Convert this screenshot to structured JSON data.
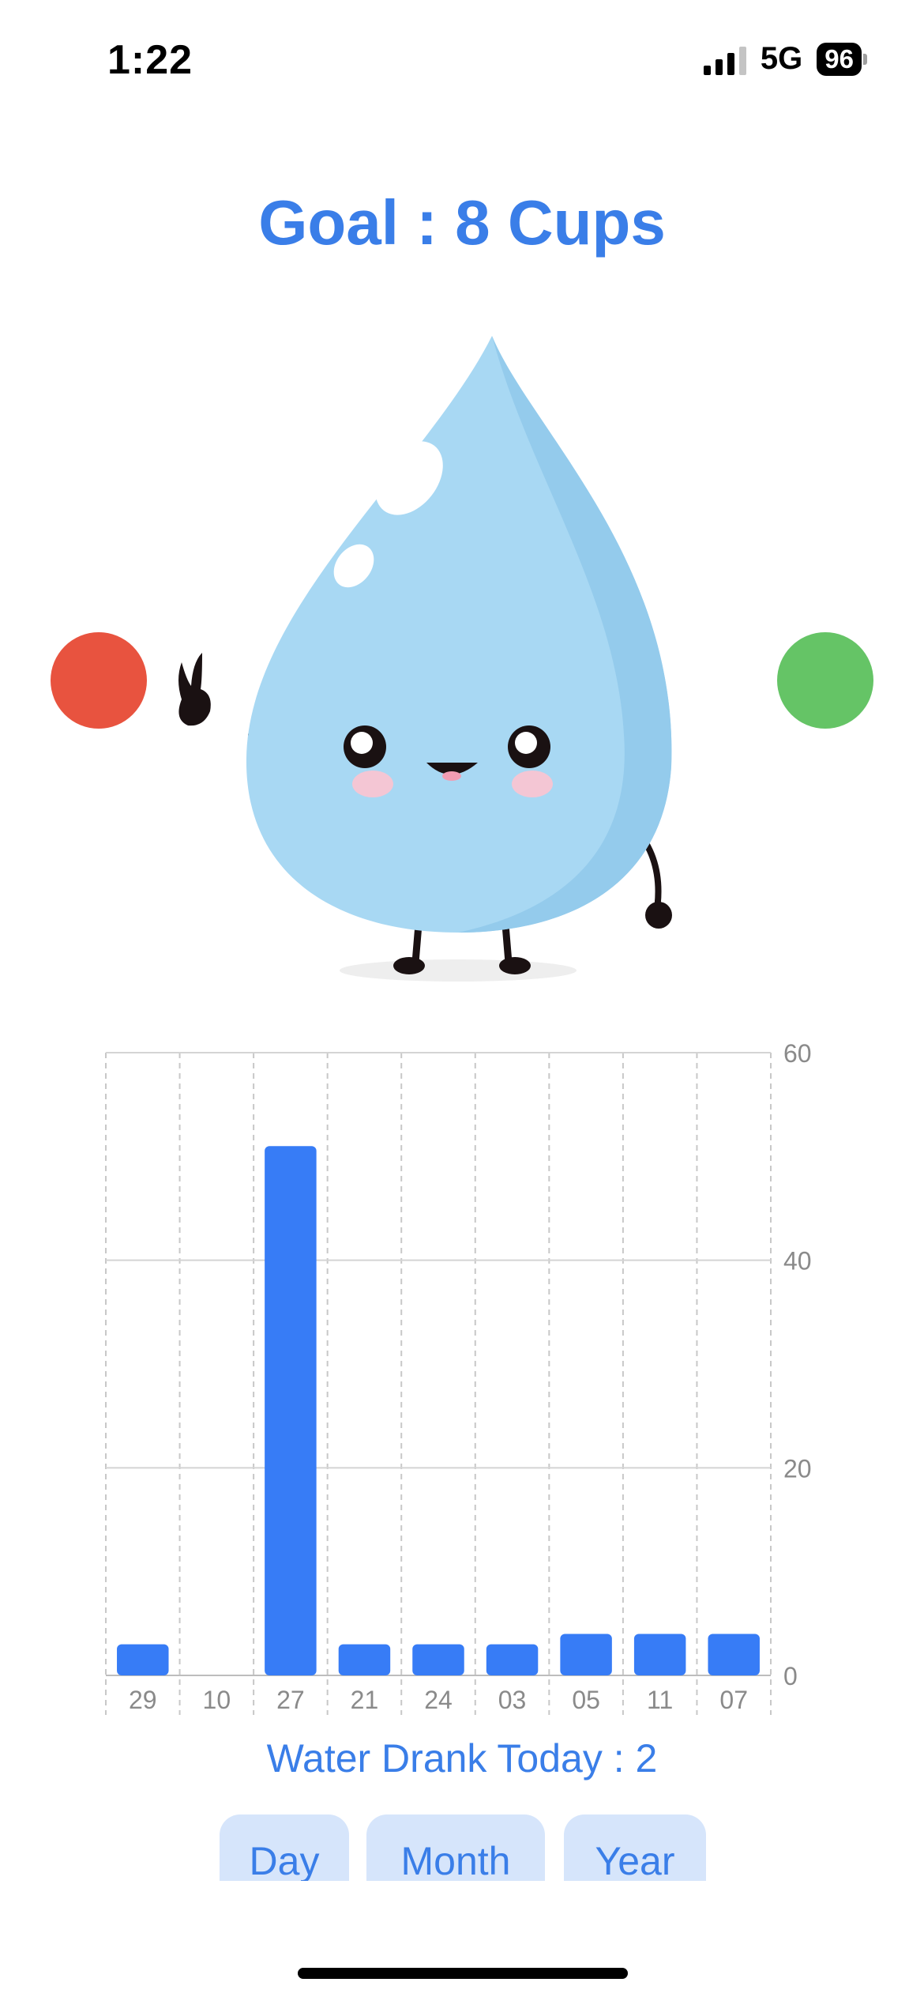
{
  "status_bar": {
    "time": "1:22",
    "network": "5G",
    "battery": "96"
  },
  "goal_title": "Goal : 8 Cups",
  "mascot_icon": "water-drop-mascot",
  "controls": {
    "remove_color": "#e8533f",
    "add_color": "#65c466"
  },
  "chart_data": {
    "type": "bar",
    "categories": [
      "29",
      "10",
      "27",
      "21",
      "24",
      "03",
      "05",
      "11",
      "07"
    ],
    "values": [
      3,
      0,
      51,
      3,
      3,
      3,
      4,
      4,
      4
    ],
    "ylim": [
      0,
      60
    ],
    "y_ticks": [
      "60",
      "40",
      "20",
      "0"
    ],
    "y_axis_position": "right",
    "grid": true,
    "bar_color": "#377cf6"
  },
  "today_label": "Water Drank Today : 2",
  "range_tabs": {
    "day": "Day",
    "month": "Month",
    "year": "Year"
  }
}
